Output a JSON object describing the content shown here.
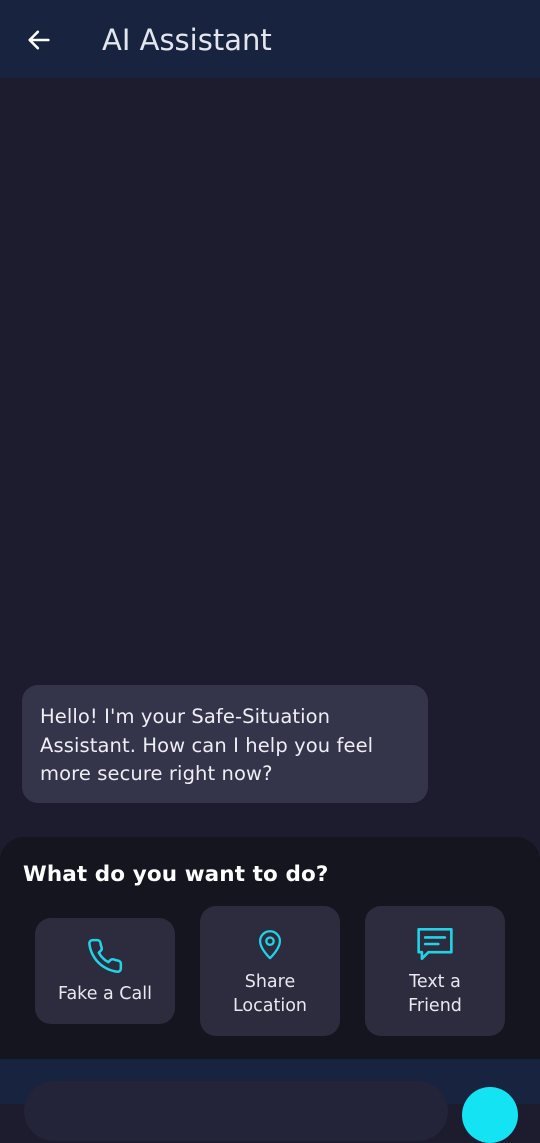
{
  "app_bar": {
    "title": "AI Assistant",
    "back_icon": "arrow-left-icon",
    "background": "#18233f"
  },
  "chat": {
    "messages": [
      {
        "sender": "assistant",
        "text": "Hello! I'm your Safe-Situation Assistant. How can I help you feel more secure right now?"
      }
    ]
  },
  "quick_actions": {
    "title": "What do you want to do?",
    "accent_color": "#22d3e6",
    "items": [
      {
        "label": "Fake a Call",
        "icon": "phone-icon"
      },
      {
        "label": "Share\nLocation",
        "icon": "location-pin-icon"
      },
      {
        "label": "Text a\nFriend",
        "icon": "chat-message-icon"
      }
    ]
  },
  "composer": {
    "input_value": "",
    "send_color": "#13e3f3"
  }
}
